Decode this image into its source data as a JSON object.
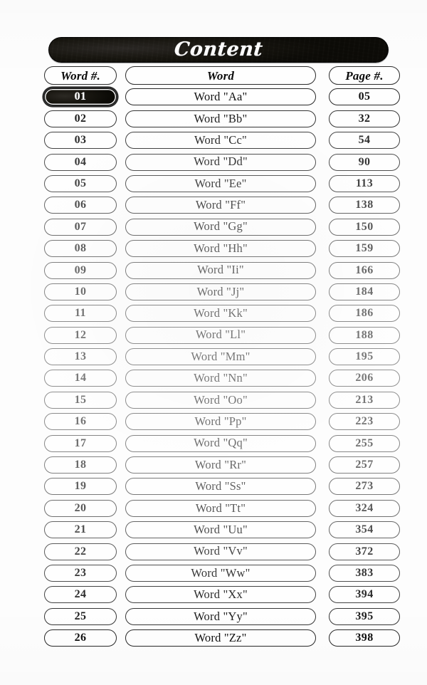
{
  "title": "Content",
  "columns": {
    "word_number": "Word #.",
    "word": "Word",
    "page_number": "Page #."
  },
  "colors": {
    "page_background": "#fdfdfd",
    "title_bar": "#0d0c08",
    "title_text": "#ffffff",
    "pill_border": "#3a3a3a",
    "text": "#111111",
    "highlight_fill": "#0c0b07",
    "highlight_text": "#ffffff"
  },
  "highlighted_row_index": 0,
  "rows": [
    {
      "num": "01",
      "word": "Word \"Aa\"",
      "page": "05"
    },
    {
      "num": "02",
      "word": "Word \"Bb\"",
      "page": "32"
    },
    {
      "num": "03",
      "word": "Word \"Cc\"",
      "page": "54"
    },
    {
      "num": "04",
      "word": "Word \"Dd\"",
      "page": "90"
    },
    {
      "num": "05",
      "word": "Word \"Ee\"",
      "page": "113"
    },
    {
      "num": "06",
      "word": "Word \"Ff\"",
      "page": "138"
    },
    {
      "num": "07",
      "word": "Word \"Gg\"",
      "page": "150"
    },
    {
      "num": "08",
      "word": "Word \"Hh\"",
      "page": "159"
    },
    {
      "num": "09",
      "word": "Word \"Ii\"",
      "page": "166"
    },
    {
      "num": "10",
      "word": "Word \"Jj\"",
      "page": "184"
    },
    {
      "num": "11",
      "word": "Word \"Kk\"",
      "page": "186"
    },
    {
      "num": "12",
      "word": "Word \"Ll\"",
      "page": "188"
    },
    {
      "num": "13",
      "word": "Word \"Mm\"",
      "page": "195"
    },
    {
      "num": "14",
      "word": "Word \"Nn\"",
      "page": "206"
    },
    {
      "num": "15",
      "word": "Word \"Oo\"",
      "page": "213"
    },
    {
      "num": "16",
      "word": "Word \"Pp\"",
      "page": "223"
    },
    {
      "num": "17",
      "word": "Word \"Qq\"",
      "page": "255"
    },
    {
      "num": "18",
      "word": "Word \"Rr\"",
      "page": "257"
    },
    {
      "num": "19",
      "word": "Word \"Ss\"",
      "page": "273"
    },
    {
      "num": "20",
      "word": "Word \"Tt\"",
      "page": "324"
    },
    {
      "num": "21",
      "word": "Word \"Uu\"",
      "page": "354"
    },
    {
      "num": "22",
      "word": "Word \"Vv\"",
      "page": "372"
    },
    {
      "num": "23",
      "word": "Word \"Ww\"",
      "page": "383"
    },
    {
      "num": "24",
      "word": "Word \"Xx\"",
      "page": "394"
    },
    {
      "num": "25",
      "word": "Word \"Yy\"",
      "page": "395"
    },
    {
      "num": "26",
      "word": "Word \"Zz\"",
      "page": "398"
    }
  ]
}
